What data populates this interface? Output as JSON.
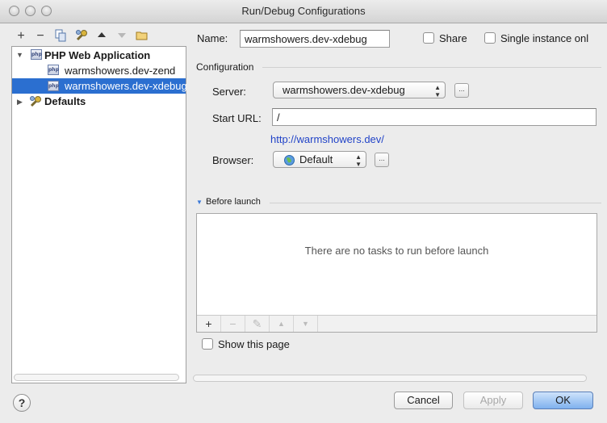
{
  "window": {
    "title": "Run/Debug Configurations"
  },
  "toolbar": {
    "icons": [
      "plus-icon",
      "minus-icon",
      "copy-icon",
      "wrench-icon",
      "move-up-icon",
      "move-down-icon",
      "folder-icon"
    ]
  },
  "tree": {
    "group_label": "PHP Web Application",
    "items": [
      {
        "label": "warmshowers.dev-zend",
        "selected": false
      },
      {
        "label": "warmshowers.dev-xdebug",
        "selected": true
      }
    ],
    "defaults_label": "Defaults"
  },
  "form": {
    "name_label": "Name:",
    "name_value": "warmshowers.dev-xdebug",
    "share_label": "Share",
    "single_instance_label": "Single instance onl",
    "configuration_header": "Configuration",
    "server_label": "Server:",
    "server_value": "warmshowers.dev-xdebug",
    "start_url_label": "Start URL:",
    "start_url_value": "/",
    "resolved_url": "http://warmshowers.dev/",
    "browser_label": "Browser:",
    "browser_value": "Default",
    "ellipsis": "..."
  },
  "before_launch": {
    "header": "Before launch",
    "empty_text": "There are no tasks to run before launch",
    "show_page_label": "Show this page"
  },
  "buttons": {
    "cancel": "Cancel",
    "apply": "Apply",
    "ok": "OK",
    "help": "?"
  },
  "colors": {
    "selection": "#2b6fd0",
    "link": "#2244c8",
    "default_button": "#7fb1ee"
  }
}
